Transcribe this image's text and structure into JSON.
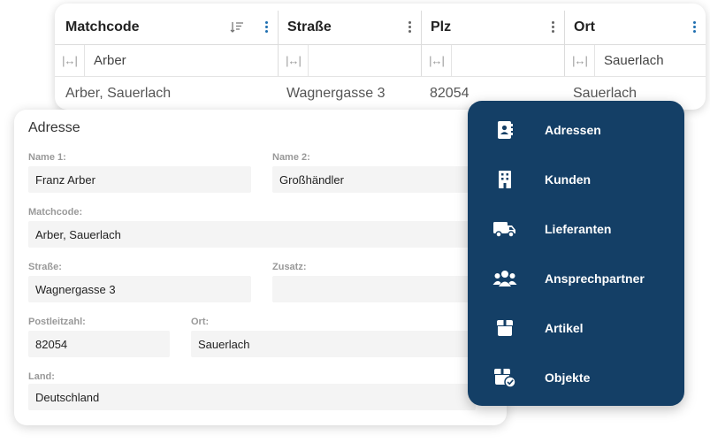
{
  "grid": {
    "columns": [
      {
        "header": "Matchcode",
        "filter": "Arber",
        "cell": "Arber, Sauerlach"
      },
      {
        "header": "Straße",
        "filter": "",
        "cell": "Wagnergasse 3"
      },
      {
        "header": "Plz",
        "filter": "",
        "cell": "82054"
      },
      {
        "header": "Ort",
        "filter": "Sauerlach",
        "cell": "Sauerlach"
      }
    ]
  },
  "form": {
    "title": "Adresse",
    "name1": {
      "label": "Name 1:",
      "value": "Franz Arber"
    },
    "name2": {
      "label": "Name 2:",
      "value": "Großhändler"
    },
    "matchcode": {
      "label": "Matchcode:",
      "value": "Arber, Sauerlach"
    },
    "strasse": {
      "label": "Straße:",
      "value": "Wagnergasse 3"
    },
    "zusatz": {
      "label": "Zusatz:",
      "value": ""
    },
    "plz": {
      "label": "Postleitzahl:",
      "value": "82054"
    },
    "ort": {
      "label": "Ort:",
      "value": "Sauerlach"
    },
    "land": {
      "label": "Land:",
      "value": "Deutschland"
    }
  },
  "menu": {
    "items": [
      {
        "label": "Adressen",
        "icon": "address-book-icon"
      },
      {
        "label": "Kunden",
        "icon": "building-icon"
      },
      {
        "label": "Lieferanten",
        "icon": "truck-icon"
      },
      {
        "label": "Ansprechpartner",
        "icon": "users-icon"
      },
      {
        "label": "Artikel",
        "icon": "box-icon"
      },
      {
        "label": "Objekte",
        "icon": "box-check-icon"
      }
    ]
  },
  "colors": {
    "menu_bg": "#143f66",
    "accent_blue": "#1f6fb0"
  }
}
